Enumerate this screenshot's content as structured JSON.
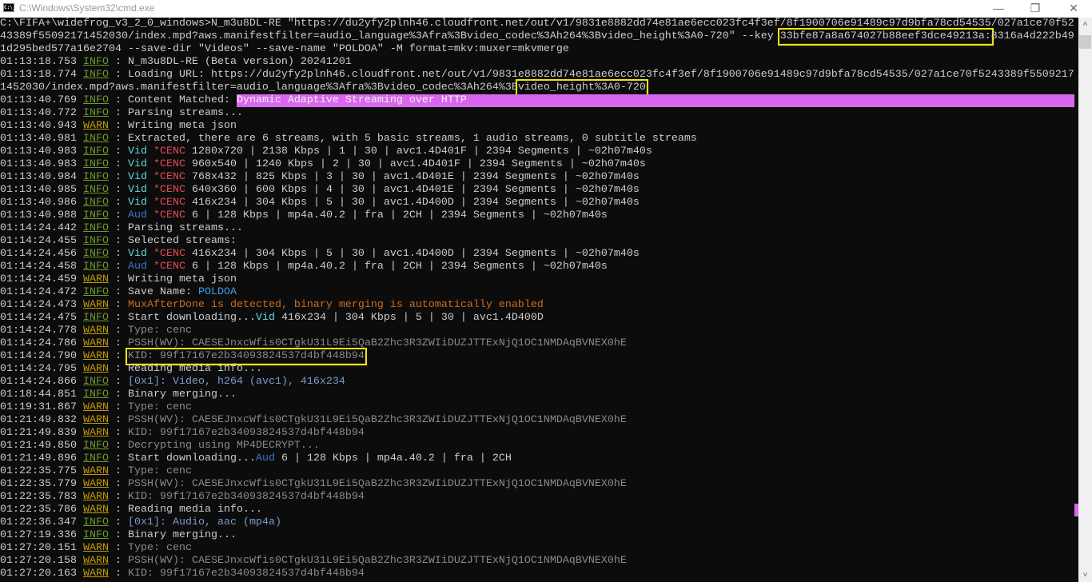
{
  "window": {
    "title": "C:\\Windows\\System32\\cmd.exe",
    "icon_text": "C:\\_",
    "minimize": "—",
    "maximize": "❐",
    "close": "✕"
  },
  "scrollbar": {
    "up": "˄",
    "down": "˅"
  },
  "lines": [
    [
      [
        "C:\\FIFA+\\widefrog_v3_2_0_windows>N_m3u8DL-RE \"https://du2yfy2plnh46.cloudfront.net/out/v1/9831e8882dd74e81ae6ecc023fc4f3ef/8f1900706e91489c97d9bfa78cd54535/027a1ce70f52",
        "w"
      ]
    ],
    [
      [
        "43389f55092171452030/index.mpd?aws.manifestfilter=audio_language%3Afra%3Bvideo_codec%3Ah264%3Bvideo_height%3A0-720\" --key ",
        "w"
      ],
      [
        "33bfe87a8a674027b88eef3dce49213a:",
        "w",
        "box"
      ],
      [
        "8316a4d222b49",
        "w"
      ]
    ],
    [
      [
        "1d295bed577a16e2704 --save-dir \"Videos\" --save-name \"POLDOA\" -M format=mkv:muxer=mkvmerge",
        "w"
      ]
    ],
    [
      [
        "01:13:18.753 ",
        "w"
      ],
      [
        "INFO",
        "info"
      ],
      [
        " : N_m3u8DL-RE (Beta version) 20241201",
        "w"
      ]
    ],
    [
      [
        "01:13:18.774 ",
        "w"
      ],
      [
        "INFO",
        "info"
      ],
      [
        " : Loading URL: https://du2yfy2plnh46.cloudfront.net/out/v1/9831e8882dd74e81ae6ecc023fc4f3ef/8f1900706e91489c97d9bfa78cd54535/027a1ce70f5243389f5509217",
        "w"
      ]
    ],
    [
      [
        "1452030/index.mpd?aws.manifestfilter=audio_language%3Afra%3Bvideo_codec%3Ah264%3B",
        "w"
      ],
      [
        "video_height%3A0-720",
        "w",
        "box"
      ]
    ],
    [
      [
        "01:13:40.769 ",
        "w"
      ],
      [
        "INFO",
        "info"
      ],
      [
        " : Content Matched: ",
        "w"
      ],
      [
        "Dynamic Adaptive Streaming over HTTP",
        "hl"
      ]
    ],
    [
      [
        "01:13:40.772 ",
        "w"
      ],
      [
        "INFO",
        "info"
      ],
      [
        " : Parsing streams...",
        "w"
      ]
    ],
    [
      [
        "01:13:40.943 ",
        "w"
      ],
      [
        "WARN",
        "warn"
      ],
      [
        " : Writing meta json",
        "w"
      ]
    ],
    [
      [
        "01:13:40.981 ",
        "w"
      ],
      [
        "INFO",
        "info"
      ],
      [
        " : Extracted, there are 6 streams, with 5 basic streams, 1 audio streams, 0 subtitle streams",
        "w"
      ]
    ],
    [
      [
        "01:13:40.983 ",
        "w"
      ],
      [
        "INFO",
        "info"
      ],
      [
        " : ",
        "w"
      ],
      [
        "Vid ",
        "vid"
      ],
      [
        "*CENC ",
        "cenc"
      ],
      [
        "1280x720 | 2138 Kbps | 1 | 30 | avc1.4D401F | 2394 Segments | ~02h07m40s",
        "w"
      ]
    ],
    [
      [
        "01:13:40.983 ",
        "w"
      ],
      [
        "INFO",
        "info"
      ],
      [
        " : ",
        "w"
      ],
      [
        "Vid ",
        "vid"
      ],
      [
        "*CENC ",
        "cenc"
      ],
      [
        "960x540 | 1240 Kbps | 2 | 30 | avc1.4D401F | 2394 Segments | ~02h07m40s",
        "w"
      ]
    ],
    [
      [
        "01:13:40.984 ",
        "w"
      ],
      [
        "INFO",
        "info"
      ],
      [
        " : ",
        "w"
      ],
      [
        "Vid ",
        "vid"
      ],
      [
        "*CENC ",
        "cenc"
      ],
      [
        "768x432 | 825 Kbps | 3 | 30 | avc1.4D401E | 2394 Segments | ~02h07m40s",
        "w"
      ]
    ],
    [
      [
        "01:13:40.985 ",
        "w"
      ],
      [
        "INFO",
        "info"
      ],
      [
        " : ",
        "w"
      ],
      [
        "Vid ",
        "vid"
      ],
      [
        "*CENC ",
        "cenc"
      ],
      [
        "640x360 | 600 Kbps | 4 | 30 | avc1.4D401E | 2394 Segments | ~02h07m40s",
        "w"
      ]
    ],
    [
      [
        "01:13:40.986 ",
        "w"
      ],
      [
        "INFO",
        "info"
      ],
      [
        " : ",
        "w"
      ],
      [
        "Vid ",
        "vid"
      ],
      [
        "*CENC ",
        "cenc"
      ],
      [
        "416x234 | 304 Kbps | 5 | 30 | avc1.4D400D | 2394 Segments | ~02h07m40s",
        "w"
      ]
    ],
    [
      [
        "01:13:40.988 ",
        "w"
      ],
      [
        "INFO",
        "info"
      ],
      [
        " : ",
        "w"
      ],
      [
        "Aud ",
        "aud"
      ],
      [
        "*CENC ",
        "cenc"
      ],
      [
        "6 | 128 Kbps | mp4a.40.2 | fra | 2CH | 2394 Segments | ~02h07m40s",
        "w"
      ]
    ],
    [
      [
        "01:14:24.442 ",
        "w"
      ],
      [
        "INFO",
        "info"
      ],
      [
        " : Parsing streams...",
        "w"
      ]
    ],
    [
      [
        "01:14:24.455 ",
        "w"
      ],
      [
        "INFO",
        "info"
      ],
      [
        " : Selected streams:",
        "w"
      ]
    ],
    [
      [
        "01:14:24.456 ",
        "w"
      ],
      [
        "INFO",
        "info"
      ],
      [
        " : ",
        "w"
      ],
      [
        "Vid ",
        "vid"
      ],
      [
        "*CENC ",
        "cenc"
      ],
      [
        "416x234 | 304 Kbps | 5 | 30 | avc1.4D400D | 2394 Segments | ~02h07m40s",
        "w"
      ]
    ],
    [
      [
        "01:14:24.458 ",
        "w"
      ],
      [
        "INFO",
        "info"
      ],
      [
        " : ",
        "w"
      ],
      [
        "Aud ",
        "aud"
      ],
      [
        "*CENC ",
        "cenc"
      ],
      [
        "6 | 128 Kbps | mp4a.40.2 | fra | 2CH | 2394 Segments | ~02h07m40s",
        "w"
      ]
    ],
    [
      [
        "01:14:24.459 ",
        "w"
      ],
      [
        "WARN",
        "warn"
      ],
      [
        " : Writing meta json",
        "w"
      ]
    ],
    [
      [
        "01:14:24.472 ",
        "w"
      ],
      [
        "INFO",
        "info"
      ],
      [
        " : Save Name: ",
        "w"
      ],
      [
        "POLDOA",
        "name"
      ]
    ],
    [
      [
        "01:14:24.473 ",
        "w"
      ],
      [
        "WARN",
        "warn"
      ],
      [
        " : ",
        "w"
      ],
      [
        "MuxAfterDone is detected, binary merging is automatically enabled",
        "orange"
      ]
    ],
    [
      [
        "01:14:24.475 ",
        "w"
      ],
      [
        "INFO",
        "info"
      ],
      [
        " : Start downloading...",
        "w"
      ],
      [
        "Vid ",
        "vid"
      ],
      [
        "416x234 | 304 Kbps | 5 | 30 | avc1.4D400D",
        "w"
      ]
    ],
    [
      [
        "01:14:24.778 ",
        "w"
      ],
      [
        "WARN",
        "warn"
      ],
      [
        " : ",
        "w"
      ],
      [
        "Type: cenc",
        "grey"
      ]
    ],
    [
      [
        "01:14:24.786 ",
        "w"
      ],
      [
        "WARN",
        "warn"
      ],
      [
        " : ",
        "w"
      ],
      [
        "PSSH(WV): CAESEJnxcWfis0CTgkU31L9Ei5QaB2Zhc3R3ZWIiDUZJTTExNjQ1OC1NMDAqBVNEX0hE",
        "grey"
      ]
    ],
    [
      [
        "01:14:24.790 ",
        "w"
      ],
      [
        "WARN",
        "warn"
      ],
      [
        " : ",
        "w"
      ],
      [
        "KID: 99f17167e2b34093824537d4bf448b94",
        "grey",
        "box"
      ]
    ],
    [
      [
        "01:14:24.795 ",
        "w"
      ],
      [
        "WARN",
        "warn"
      ],
      [
        " : Reading media info...",
        "w"
      ]
    ],
    [
      [
        "01:14:24.866 ",
        "w"
      ],
      [
        "INFO",
        "info"
      ],
      [
        " : ",
        "w"
      ],
      [
        "[0x1]: Video, h264 (avc1), 416x234",
        "blue"
      ]
    ],
    [
      [
        "01:18:44.851 ",
        "w"
      ],
      [
        "INFO",
        "info"
      ],
      [
        " : Binary merging...",
        "w"
      ]
    ],
    [
      [
        "01:19:31.867 ",
        "w"
      ],
      [
        "WARN",
        "warn"
      ],
      [
        " : ",
        "w"
      ],
      [
        "Type: cenc",
        "grey"
      ]
    ],
    [
      [
        "01:21:49.832 ",
        "w"
      ],
      [
        "WARN",
        "warn"
      ],
      [
        " : ",
        "w"
      ],
      [
        "PSSH(WV): CAESEJnxcWfis0CTgkU31L9Ei5QaB2Zhc3R3ZWIiDUZJTTExNjQ1OC1NMDAqBVNEX0hE",
        "grey"
      ]
    ],
    [
      [
        "01:21:49.839 ",
        "w"
      ],
      [
        "WARN",
        "warn"
      ],
      [
        " : ",
        "w"
      ],
      [
        "KID: 99f17167e2b34093824537d4bf448b94",
        "grey"
      ]
    ],
    [
      [
        "01:21:49.850 ",
        "w"
      ],
      [
        "INFO",
        "info"
      ],
      [
        " : ",
        "w"
      ],
      [
        "Decrypting using MP4DECRYPT...",
        "grey"
      ]
    ],
    [
      [
        "01:21:49.896 ",
        "w"
      ],
      [
        "INFO",
        "info"
      ],
      [
        " : Start downloading...",
        "w"
      ],
      [
        "Aud ",
        "aud"
      ],
      [
        "6 | 128 Kbps | mp4a.40.2 | fra | 2CH",
        "w"
      ]
    ],
    [
      [
        "01:22:35.775 ",
        "w"
      ],
      [
        "WARN",
        "warn"
      ],
      [
        " : ",
        "w"
      ],
      [
        "Type: cenc",
        "grey"
      ]
    ],
    [
      [
        "01:22:35.779 ",
        "w"
      ],
      [
        "WARN",
        "warn"
      ],
      [
        " : ",
        "w"
      ],
      [
        "PSSH(WV): CAESEJnxcWfis0CTgkU31L9Ei5QaB2Zhc3R3ZWIiDUZJTTExNjQ1OC1NMDAqBVNEX0hE",
        "grey"
      ]
    ],
    [
      [
        "01:22:35.783 ",
        "w"
      ],
      [
        "WARN",
        "warn"
      ],
      [
        " : ",
        "w"
      ],
      [
        "KID: 99f17167e2b34093824537d4bf448b94",
        "grey"
      ]
    ],
    [
      [
        "01:22:35.786 ",
        "w"
      ],
      [
        "WARN",
        "warn"
      ],
      [
        " : Reading media info...",
        "w"
      ]
    ],
    [
      [
        "01:22:36.347 ",
        "w"
      ],
      [
        "INFO",
        "info"
      ],
      [
        " : ",
        "w"
      ],
      [
        "[0x1]: Audio, aac (mp4a)",
        "blue"
      ]
    ],
    [
      [
        "01:27:19.336 ",
        "w"
      ],
      [
        "INFO",
        "info"
      ],
      [
        " : Binary merging...",
        "w"
      ]
    ],
    [
      [
        "01:27:20.151 ",
        "w"
      ],
      [
        "WARN",
        "warn"
      ],
      [
        " : ",
        "w"
      ],
      [
        "Type: cenc",
        "grey"
      ]
    ],
    [
      [
        "01:27:20.158 ",
        "w"
      ],
      [
        "WARN",
        "warn"
      ],
      [
        " : ",
        "w"
      ],
      [
        "PSSH(WV): CAESEJnxcWfis0CTgkU31L9Ei5QaB2Zhc3R3ZWIiDUZJTTExNjQ1OC1NMDAqBVNEX0hE",
        "grey"
      ]
    ],
    [
      [
        "01:27:20.163 ",
        "w"
      ],
      [
        "WARN",
        "warn"
      ],
      [
        " : ",
        "w"
      ],
      [
        "KID: 99f17167e2b34093824537d4bf448b94",
        "grey"
      ]
    ]
  ]
}
